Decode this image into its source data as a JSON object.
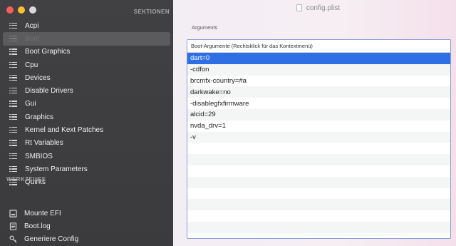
{
  "window": {
    "title": "config.plist"
  },
  "traffic_lights": {
    "close": "#ff5f57",
    "minimize": "#febc2e",
    "zoom": "#d9d9d9"
  },
  "sidebar": {
    "sections_header": "SEKTIONEN",
    "items": [
      {
        "label": "Acpi",
        "icon": "list-icon",
        "selected": false
      },
      {
        "label": "Boot",
        "icon": "list-icon",
        "selected": true
      },
      {
        "label": "Boot Graphics",
        "icon": "list-icon",
        "selected": false
      },
      {
        "label": "Cpu",
        "icon": "list-icon",
        "selected": false
      },
      {
        "label": "Devices",
        "icon": "list-icon",
        "selected": false
      },
      {
        "label": "Disable Drivers",
        "icon": "list-icon",
        "selected": false
      },
      {
        "label": "Gui",
        "icon": "list-icon",
        "selected": false
      },
      {
        "label": "Graphics",
        "icon": "list-icon",
        "selected": false
      },
      {
        "label": "Kernel and Kext Patches",
        "icon": "list-icon",
        "selected": false
      },
      {
        "label": "Rt Variables",
        "icon": "list-icon",
        "selected": false
      },
      {
        "label": "SMBIOS",
        "icon": "list-icon",
        "selected": false
      },
      {
        "label": "System Parameters",
        "icon": "list-icon",
        "selected": false
      },
      {
        "label": "Quirks",
        "icon": "list-icon",
        "selected": false
      }
    ],
    "tools_header": "WERKZEUGE",
    "tools": [
      {
        "label": "Mounte EFI",
        "icon": "disk-icon"
      },
      {
        "label": "Boot.log",
        "icon": "document-icon"
      },
      {
        "label": "Generiere Config",
        "icon": "key-icon"
      }
    ]
  },
  "main": {
    "section_label": "Arguments",
    "table": {
      "header": "Boot-Argumente (Rechtsklick für das Kontextmenü)",
      "rows": [
        "dart=0",
        "-cdfon",
        "brcmfx-country=#a",
        "darkwake=no",
        "-disablegfxfirmware",
        "alcid=29",
        "nvda_drv=1",
        "-v",
        "",
        "",
        "",
        "",
        "",
        "",
        "",
        ""
      ],
      "selected_index": 0
    }
  },
  "colors": {
    "accent": "#2f6fe6",
    "sidebar_bg": "#3e3e40",
    "table_border": "#8a9fd6"
  }
}
